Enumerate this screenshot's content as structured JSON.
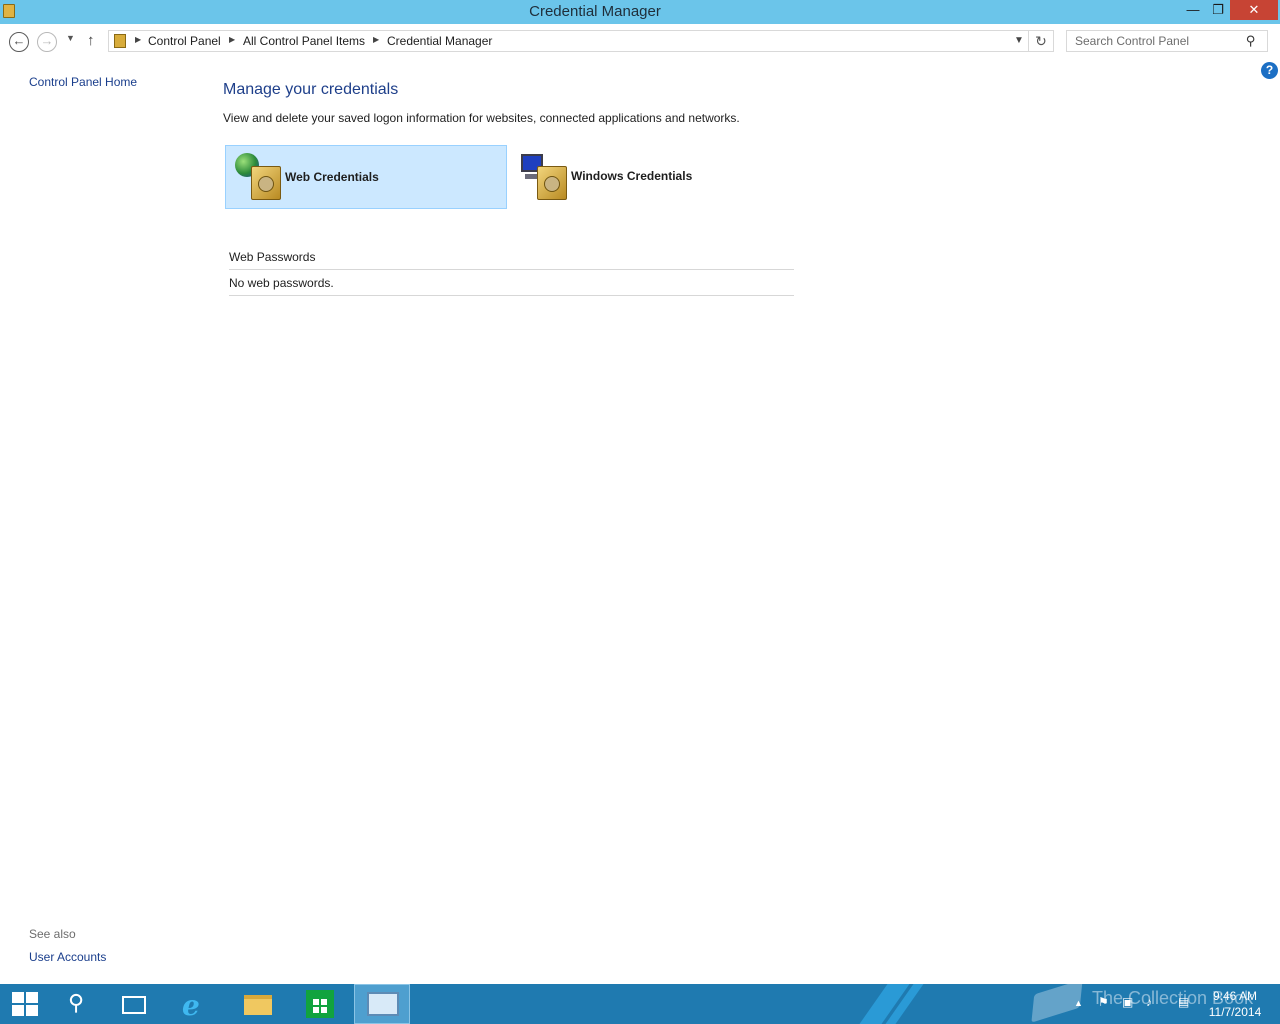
{
  "window": {
    "title": "Credential Manager",
    "minimize_glyph": "—",
    "maximize_glyph": "❐",
    "close_glyph": "✕"
  },
  "navigation": {
    "back_glyph": "←",
    "forward_glyph": "→",
    "recent_glyph": "▼",
    "up_glyph": "↑",
    "refresh_glyph": "↻",
    "breadcrumbs": [
      "Control Panel",
      "All Control Panel Items",
      "Credential Manager"
    ],
    "search_placeholder": "Search Control Panel",
    "search_value": ""
  },
  "left_pane": {
    "home_link": "Control Panel Home",
    "see_also_label": "See also",
    "see_also_links": [
      "User Accounts"
    ]
  },
  "main": {
    "heading": "Manage your credentials",
    "description": "View and delete your saved logon information for websites, connected applications and networks.",
    "tiles": [
      {
        "label": "Web Credentials",
        "selected": true
      },
      {
        "label": "Windows Credentials",
        "selected": false
      }
    ],
    "section_header": "Web Passwords",
    "empty_message": "No web passwords."
  },
  "help_glyph": "?",
  "taskbar": {
    "apps": [
      "start",
      "search",
      "task-view",
      "internet-explorer",
      "file-explorer",
      "store",
      "control-panel"
    ],
    "active_app": "control-panel",
    "time": "9:46 AM",
    "date": "11/7/2014",
    "watermark": "The Collection Book"
  },
  "colors": {
    "titlebar": "#6bc5ea",
    "taskbar": "#1f7ab0",
    "link": "#1a3e8c",
    "heading": "#1e3f8a",
    "selected_tile": "#cce8ff",
    "close_button": "#c74434"
  }
}
